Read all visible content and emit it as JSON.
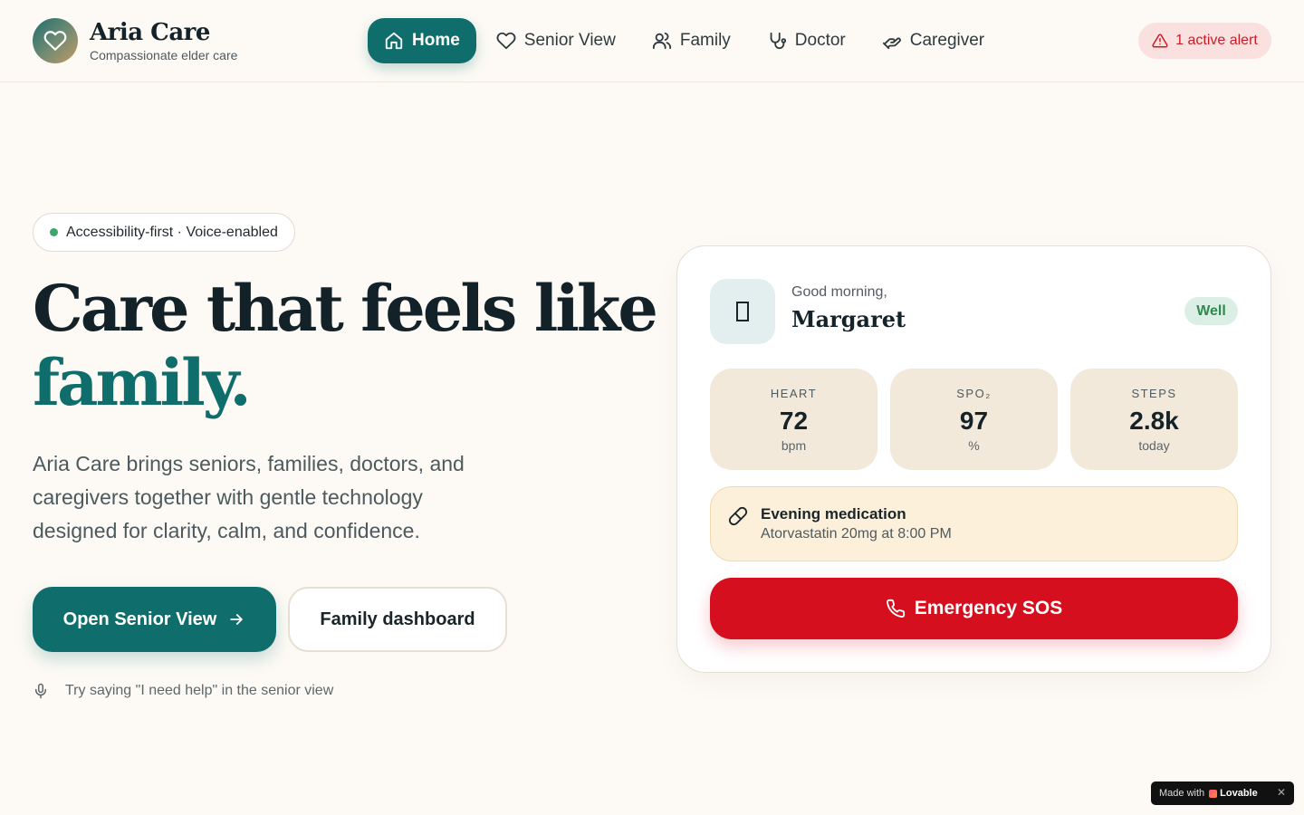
{
  "brand": {
    "name": "Aria Care",
    "tagline": "Compassionate elder care"
  },
  "nav": {
    "items": [
      {
        "label": "Home",
        "icon": "home-icon",
        "active": true
      },
      {
        "label": "Senior View",
        "icon": "heart-icon",
        "active": false
      },
      {
        "label": "Family",
        "icon": "users-icon",
        "active": false
      },
      {
        "label": "Doctor",
        "icon": "stethoscope-icon",
        "active": false
      },
      {
        "label": "Caregiver",
        "icon": "hand-heart-icon",
        "active": false
      }
    ]
  },
  "alert": {
    "label": "1 active alert",
    "color": "#c81d25"
  },
  "hero": {
    "badge": "Accessibility-first · Voice-enabled",
    "title_line1": "Care that feels like",
    "title_line2": "family.",
    "subtitle": "Aria Care brings seniors, families, doctors, and caregivers together with gentle technology designed for clarity, calm, and confidence.",
    "primary_cta": "Open Senior View",
    "secondary_cta": "Family dashboard",
    "voice_hint": "Try saying \"I need help\" in the senior view"
  },
  "card": {
    "greeting": "Good morning,",
    "name": "Margaret",
    "status": "Well",
    "vitals": [
      {
        "label": "HEART",
        "value": "72",
        "unit": "bpm"
      },
      {
        "label": "SPO₂",
        "value": "97",
        "unit": "%"
      },
      {
        "label": "STEPS",
        "value": "2.8k",
        "unit": "today"
      }
    ],
    "medication": {
      "title": "Evening medication",
      "detail": "Atorvastatin 20mg at 8:00 PM"
    },
    "sos_label": "Emergency SOS"
  },
  "made_with": {
    "prefix": "Made with",
    "brand": "Lovable",
    "close": "✕"
  },
  "colors": {
    "primary": "#0f6e6c",
    "danger": "#d60f1e",
    "background": "#fdfaf5",
    "vital_bg": "#f2e9da"
  }
}
